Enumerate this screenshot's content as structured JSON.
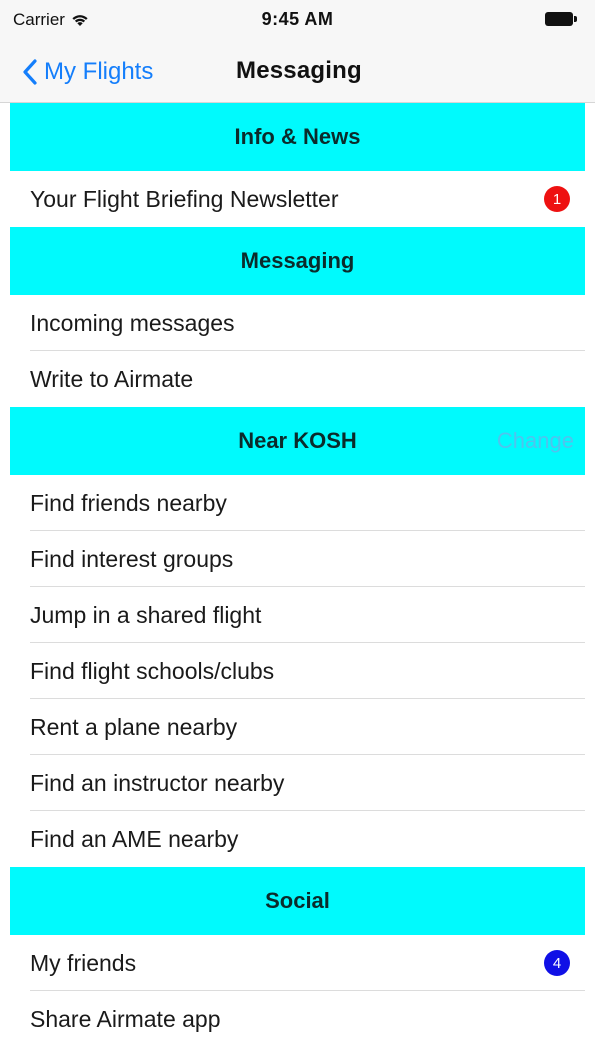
{
  "status_bar": {
    "carrier": "Carrier",
    "time": "9:45 AM",
    "wifi_icon": "wifi-icon",
    "battery_icon": "battery-icon"
  },
  "nav": {
    "back_label": "My Flights",
    "back_icon": "chevron-left-icon",
    "title": "Messaging"
  },
  "colors": {
    "section_header_bg": "#00fafd",
    "link_blue": "#147efb",
    "change_link": "#4fc4ee",
    "badge_red": "#ee1111",
    "badge_blue": "#1010e6"
  },
  "sections": [
    {
      "title": "Info & News",
      "rows": [
        {
          "label": "Your Flight Briefing Newsletter",
          "badge": "1",
          "badge_color": "red"
        }
      ]
    },
    {
      "title": "Messaging",
      "rows": [
        {
          "label": "Incoming messages"
        },
        {
          "label": "Write to Airmate"
        }
      ]
    },
    {
      "title": "Near KOSH",
      "action": "Change",
      "rows": [
        {
          "label": "Find friends nearby"
        },
        {
          "label": "Find interest groups"
        },
        {
          "label": "Jump in a shared flight"
        },
        {
          "label": "Find flight schools/clubs"
        },
        {
          "label": "Rent a plane nearby"
        },
        {
          "label": "Find an instructor nearby"
        },
        {
          "label": "Find an AME nearby"
        }
      ]
    },
    {
      "title": "Social",
      "rows": [
        {
          "label": "My friends",
          "badge": "4",
          "badge_color": "blue"
        },
        {
          "label": "Share Airmate app"
        }
      ]
    }
  ]
}
